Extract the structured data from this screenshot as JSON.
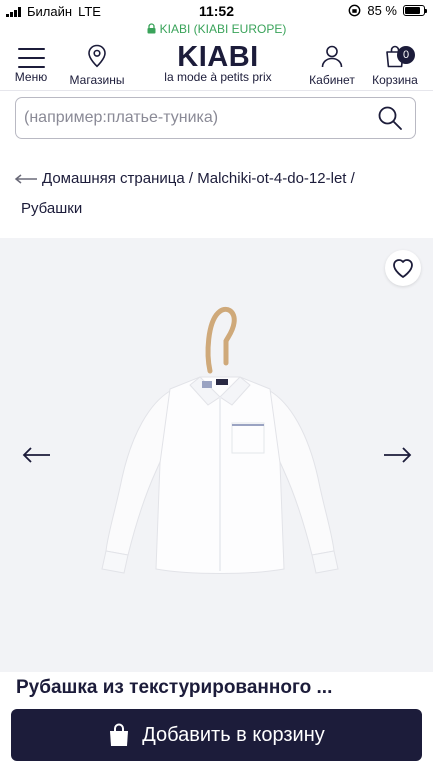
{
  "status_bar": {
    "carrier": "Билайн",
    "network": "LTE",
    "time": "11:52",
    "battery": "85 %",
    "battery_level": 0.85
  },
  "browser": {
    "url_text": "KIABI (KIABI EUROPE)"
  },
  "header": {
    "menu_label": "Меню",
    "stores_label": "Магазины",
    "logo_text": "KIABI",
    "logo_tagline": "la mode à petits prix",
    "account_label": "Кабинет",
    "cart_label": "Корзина",
    "cart_count": "0"
  },
  "search": {
    "placeholder": "(например:платье-туника)",
    "value": ""
  },
  "breadcrumb": {
    "home": "Домашняя страница",
    "sep1": "/",
    "category": "Malchiki-ot-4-do-12-let",
    "sep2": "/",
    "current": "Рубашки"
  },
  "product": {
    "title": "Рубашка из текстурированного ...",
    "add_to_cart": "Добавить в корзину"
  },
  "colors": {
    "brand": "#1c1c3a",
    "secure": "#3aa35a",
    "gallery_bg": "#f2f3f6"
  },
  "icons": [
    "menu-icon",
    "store-pin-icon",
    "account-icon",
    "cart-icon",
    "search-icon",
    "back-arrow-icon",
    "heart-icon",
    "arrow-left-icon",
    "arrow-right-icon",
    "shopping-bag-icon"
  ]
}
